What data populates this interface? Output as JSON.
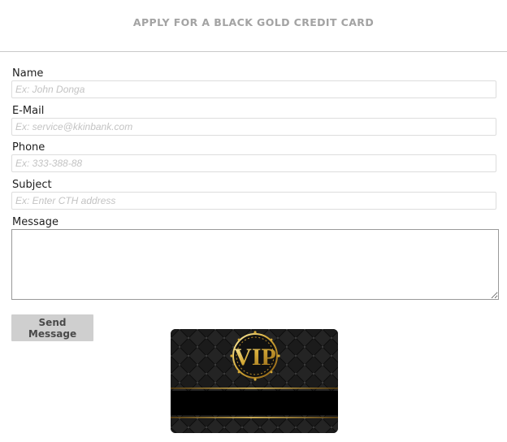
{
  "header": {
    "title": "APPLY FOR A BLACK GOLD CREDIT CARD"
  },
  "form": {
    "name": {
      "label": "Name",
      "placeholder": "Ex: John Donga"
    },
    "email": {
      "label": "E-Mail",
      "placeholder": "Ex: service@kkinbank.com"
    },
    "phone": {
      "label": "Phone",
      "placeholder": "Ex: 333-388-88"
    },
    "subject": {
      "label": "Subject",
      "placeholder": "Ex: Enter CTH address"
    },
    "message": {
      "label": "Message",
      "value": ""
    },
    "send_label": "Send Message"
  },
  "card": {
    "emblem_text": "VIP",
    "colors": {
      "base": "#161616",
      "gold": "#d4a937"
    }
  }
}
